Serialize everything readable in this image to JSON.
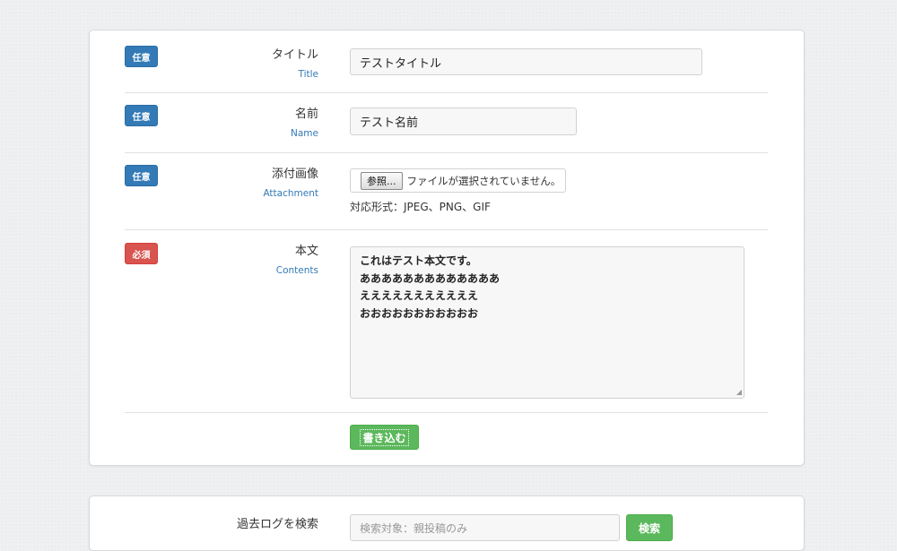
{
  "form": {
    "title_field": {
      "badge": "任意",
      "label_jp": "タイトル",
      "label_en": "Title",
      "value": "テストタイトル"
    },
    "name_field": {
      "badge": "任意",
      "label_jp": "名前",
      "label_en": "Name",
      "value": "テスト名前"
    },
    "attachment_field": {
      "badge": "任意",
      "label_jp": "添付画像",
      "label_en": "Attachment",
      "browse_label": "参照...",
      "status_text": "ファイルが選択されていません。",
      "formats_text": "対応形式：JPEG、PNG、GIF"
    },
    "contents_field": {
      "badge": "必須",
      "label_jp": "本文",
      "label_en": "Contents",
      "lines": [
        "これはテスト本文です。",
        "あああああああああああああ",
        "えええええええええええ",
        "おおおおおおおおおおお"
      ]
    },
    "submit_label": "書き込む"
  },
  "search": {
    "label": "過去ログを検索",
    "placeholder": "検索対象：親投稿のみ",
    "button_label": "検索"
  },
  "colors": {
    "optional_badge": "#337ab7",
    "required_badge": "#d9534f",
    "submit": "#5cb85c",
    "label_en": "#337ab7"
  }
}
